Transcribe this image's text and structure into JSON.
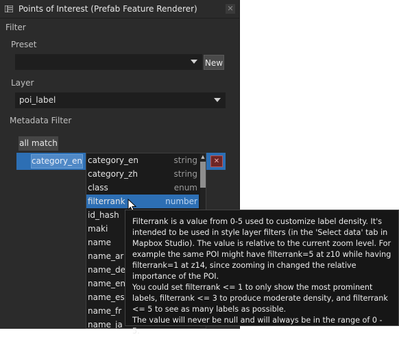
{
  "window": {
    "title": "Points of Interest (Prefab Feature Renderer)",
    "icon": "panel-icon",
    "close_label": "✕"
  },
  "filter_section": {
    "label": "Filter"
  },
  "preset": {
    "label": "Preset",
    "value": "",
    "new_button": "New"
  },
  "layer": {
    "label": "Layer",
    "value": "poi_label"
  },
  "metadata_filter": {
    "label": "Metadata Filter",
    "all_match_button": "all match",
    "chip_label": "category_en",
    "remove_label": "✕"
  },
  "dropdown": {
    "items": [
      {
        "name": "category_en",
        "type": "string"
      },
      {
        "name": "category_zh",
        "type": "string"
      },
      {
        "name": "class",
        "type": "enum"
      },
      {
        "name": "filterrank",
        "type": "number"
      },
      {
        "name": "id_hash",
        "type": ""
      },
      {
        "name": "maki",
        "type": ""
      },
      {
        "name": "name",
        "type": ""
      },
      {
        "name": "name_ar",
        "type": ""
      },
      {
        "name": "name_de",
        "type": ""
      },
      {
        "name": "name_en",
        "type": ""
      },
      {
        "name": "name_es",
        "type": ""
      },
      {
        "name": "name_fr",
        "type": ""
      },
      {
        "name": "name_ja",
        "type": ""
      }
    ],
    "selected": "filterrank"
  },
  "tooltip": {
    "p1": "Filterrank is a value from 0-5 used to customize label density. It's intended to be used in style layer filters (in the 'Select data' tab in Mapbox Studio). The value is relative to the current zoom level. For example the same POI might have filterrank=5 at z10 while having filterrank=1 at z14, since zooming in changed the relative importance of the POI.",
    "p2": "You could set filterrank <= 1 to only show the most prominent labels, filterrank <= 3 to produce moderate density, and filterrank <= 5 to see as many labels as possible.",
    "p3": "The value will never be null and will always be in the range of 0 - 5."
  },
  "colors": {
    "panel_bg": "#2b2b2b",
    "selection": "#2d6fb4",
    "tooltip_bg": "#161616"
  }
}
